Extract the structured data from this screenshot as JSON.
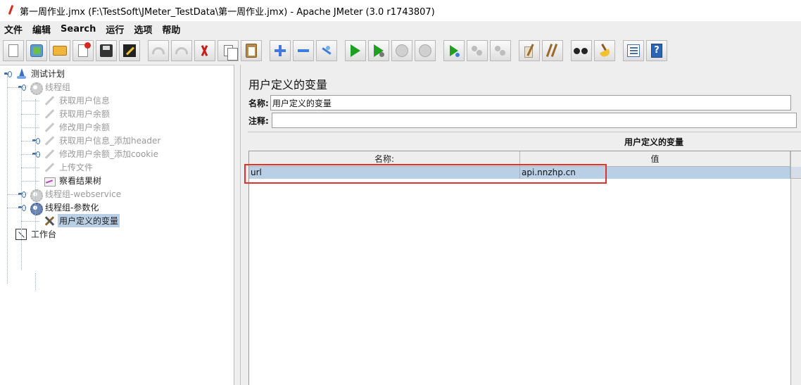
{
  "window": {
    "title": "第一周作业.jmx (F:\\TestSoft\\JMeter_TestData\\第一周作业.jmx) - Apache JMeter (3.0 r1743807)"
  },
  "menu": [
    "文件",
    "编辑",
    "Search",
    "运行",
    "选项",
    "帮助"
  ],
  "toolbar": [
    {
      "name": "new-icon",
      "cls": "i-new"
    },
    {
      "name": "templates-icon",
      "cls": "i-templ"
    },
    {
      "name": "open-icon",
      "cls": "i-open"
    },
    {
      "name": "close-icon",
      "cls": "i-close"
    },
    {
      "name": "save-icon",
      "cls": "i-save"
    },
    {
      "name": "save-as-icon",
      "cls": "i-saveas",
      "sep_after": true
    },
    {
      "name": "undo-icon",
      "cls": "i-undo"
    },
    {
      "name": "redo-icon",
      "cls": "i-redo"
    },
    {
      "name": "cut-icon",
      "cls": "i-cut"
    },
    {
      "name": "copy-icon",
      "cls": "i-copy"
    },
    {
      "name": "paste-icon",
      "cls": "i-paste",
      "sep_after": true
    },
    {
      "name": "expand-icon",
      "cls": "i-plus"
    },
    {
      "name": "collapse-icon",
      "cls": "i-minus"
    },
    {
      "name": "toggle-icon",
      "cls": "i-toggle",
      "sep_after": true
    },
    {
      "name": "start-icon",
      "cls": "i-play"
    },
    {
      "name": "start-no-pause-icon",
      "cls": "i-playnp"
    },
    {
      "name": "stop-icon",
      "cls": "i-stop"
    },
    {
      "name": "shutdown-icon",
      "cls": "i-shutdown",
      "sep_after": true
    },
    {
      "name": "remote-start-icon",
      "cls": "i-rstart"
    },
    {
      "name": "remote-stop-icon",
      "cls": "i-rstop"
    },
    {
      "name": "remote-shutdown-icon",
      "cls": "i-rshut",
      "sep_after": true
    },
    {
      "name": "clear-icon",
      "cls": "i-clear"
    },
    {
      "name": "clear-all-icon",
      "cls": "i-clearall",
      "sep_after": true
    },
    {
      "name": "search-icon",
      "cls": "i-search"
    },
    {
      "name": "reset-search-icon",
      "cls": "i-reset",
      "sep_after": true
    },
    {
      "name": "function-helper-icon",
      "cls": "i-list"
    },
    {
      "name": "help-icon",
      "cls": "i-help",
      "glyph": "?"
    }
  ],
  "tree": [
    {
      "label": "测试计划",
      "icon": "t-plan",
      "icon_name": "test-plan-icon",
      "level": 0,
      "handle": true,
      "state": "normal"
    },
    {
      "label": "线程组",
      "icon": "t-gear",
      "icon_name": "thread-group-icon",
      "level": 1,
      "handle": true,
      "state": "disabled"
    },
    {
      "label": "获取用户信息",
      "icon": "t-pen",
      "icon_name": "sampler-icon",
      "level": 2,
      "state": "disabled"
    },
    {
      "label": "获取用户余额",
      "icon": "t-pen",
      "icon_name": "sampler-icon",
      "level": 2,
      "state": "disabled"
    },
    {
      "label": "修改用户余额",
      "icon": "t-pen",
      "icon_name": "sampler-icon",
      "level": 2,
      "state": "disabled"
    },
    {
      "label": "获取用户信息_添加header",
      "icon": "t-pen",
      "icon_name": "sampler-icon",
      "level": 2,
      "handle": true,
      "state": "disabled"
    },
    {
      "label": "修改用户余额_添加cookie",
      "icon": "t-pen",
      "icon_name": "sampler-icon",
      "level": 2,
      "handle": true,
      "state": "disabled"
    },
    {
      "label": "上传文件",
      "icon": "t-pen",
      "icon_name": "sampler-icon",
      "level": 2,
      "state": "disabled"
    },
    {
      "label": "察看结果树",
      "icon": "t-chart",
      "icon_name": "result-tree-icon",
      "level": 2,
      "state": "normal"
    },
    {
      "label": "线程组-webservice",
      "icon": "t-gear",
      "icon_name": "thread-group-icon",
      "level": 1,
      "handle": true,
      "state": "disabled"
    },
    {
      "label": "线程组-参数化",
      "icon": "t-gear active",
      "icon_name": "thread-group-icon",
      "level": 1,
      "handle": true,
      "state": "normal"
    },
    {
      "label": "用户定义的变量",
      "icon": "t-tools",
      "icon_name": "config-tools-icon",
      "level": 2,
      "state": "selected"
    },
    {
      "label": "工作台",
      "icon": "t-bench",
      "icon_name": "workbench-icon",
      "level": 0,
      "state": "normal"
    }
  ],
  "panel": {
    "title": "用户定义的变量",
    "name_label": "名称:",
    "name_value": "用户定义的变量",
    "comment_label": "注释:",
    "comment_value": "",
    "table_title": "用户定义的变量",
    "columns": [
      "名称:",
      "值"
    ],
    "rows": [
      [
        "url",
        "api.nnzhp.cn"
      ]
    ]
  }
}
